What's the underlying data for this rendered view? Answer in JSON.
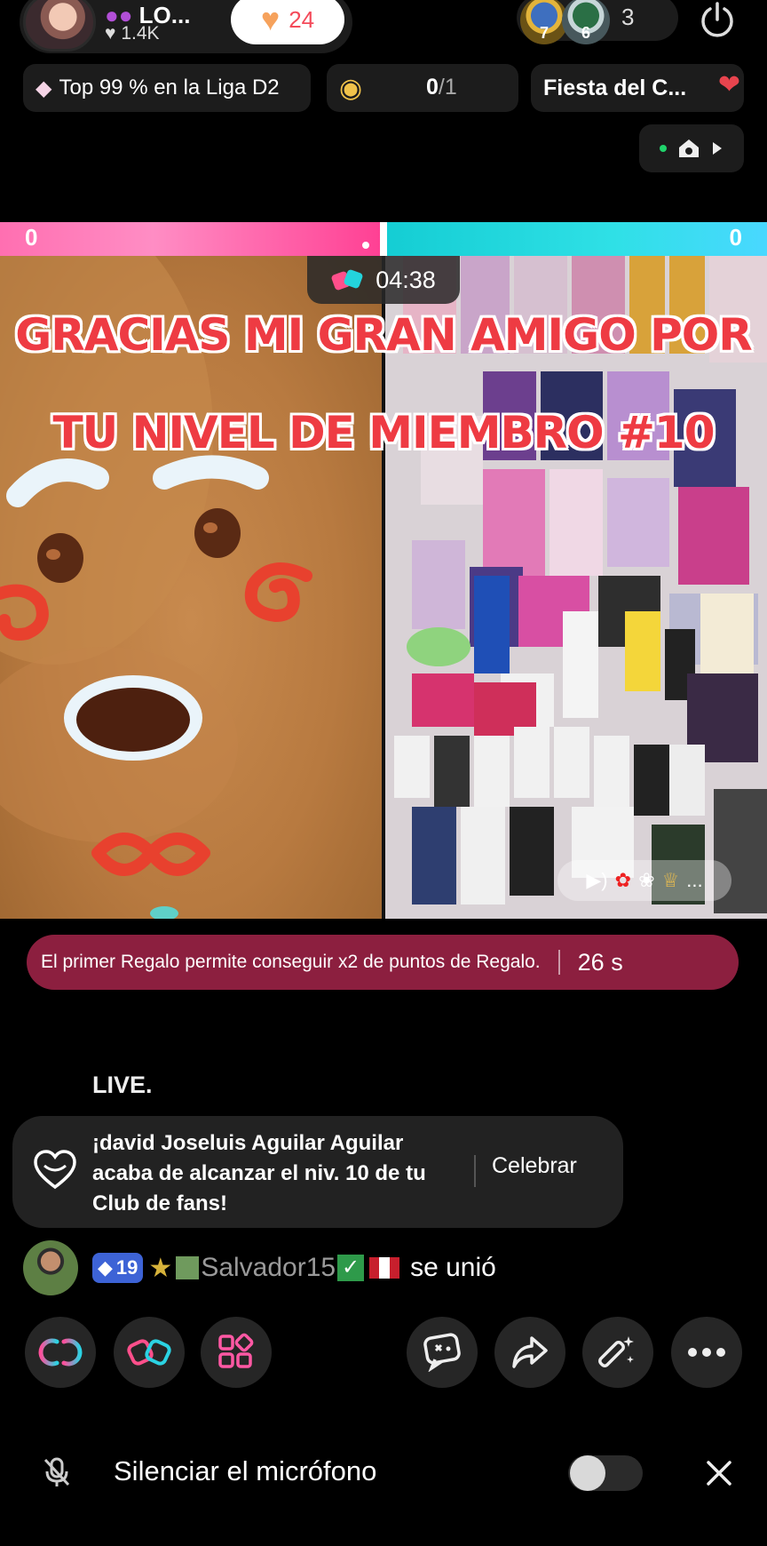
{
  "header": {
    "host_name": "LO...",
    "host_likes": "1.4K",
    "like_count": "24",
    "viewer_badges": [
      "7",
      "6"
    ],
    "viewer_count": "3",
    "league_text": "Top 99 % en la Liga D2",
    "goal_value": "0",
    "goal_total": "/1",
    "event_text": "Fiesta del C..."
  },
  "battle": {
    "score_left": "0",
    "score_right": "0",
    "timer": "04:38",
    "progress_left": 0.5
  },
  "overlay": {
    "line1": "GRACIAS MI GRAN AMIGO  POR",
    "line2": "TU NIVEL DE MIEMBRO #10"
  },
  "banner": {
    "message": "El primer Regalo permite conseguir x2 de puntos de Regalo.",
    "countdown": "26 s"
  },
  "chat": {
    "live_text": "LIVE.",
    "fan_club_message": "¡david Joseluis Aguilar Aguilar acaba de alcanzar el niv. 10 de tu Club de fans!",
    "fan_club_button": "Celebrar",
    "join": {
      "level": "19",
      "name": "Salvador15",
      "action": "se unió"
    }
  },
  "footer": {
    "mute_label": "Silenciar el micrófono",
    "mute_on": false
  },
  "colors": {
    "pink": "#ff4fa0",
    "cyan": "#20d6dc",
    "banner": "#8c1f3f",
    "overlay_text": "#ee3b43"
  }
}
